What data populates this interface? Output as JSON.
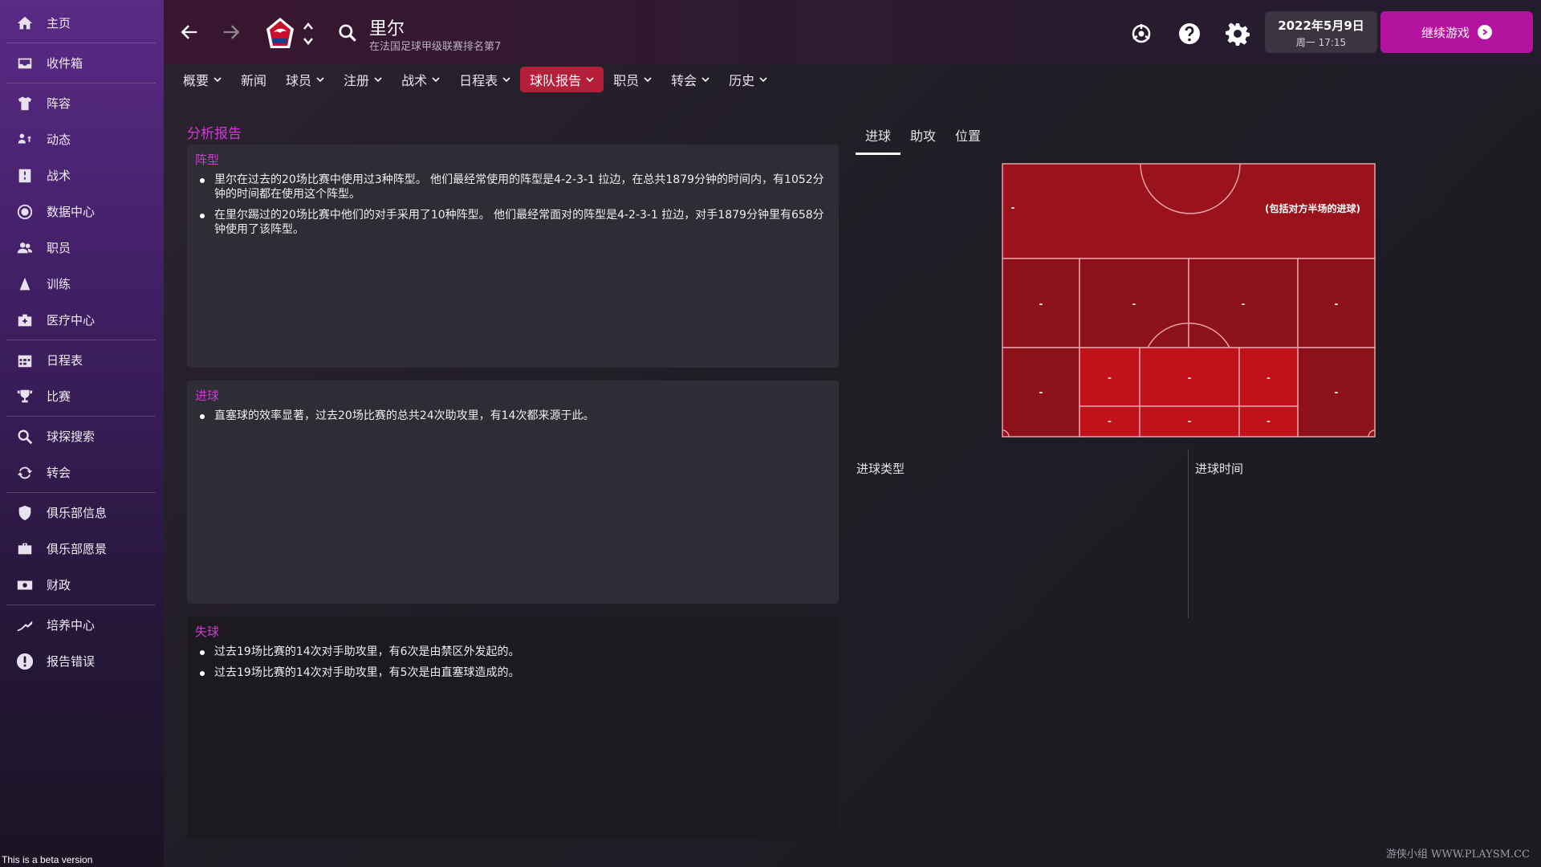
{
  "sidebar": {
    "items": [
      {
        "label": "主页",
        "icon": "home-icon"
      },
      {
        "label": "收件箱",
        "icon": "inbox-icon"
      },
      {
        "label": "阵容",
        "icon": "shirt-icon"
      },
      {
        "label": "动态",
        "icon": "dynamics-icon"
      },
      {
        "label": "战术",
        "icon": "tactics-icon"
      },
      {
        "label": "数据中心",
        "icon": "data-hub-icon"
      },
      {
        "label": "职员",
        "icon": "staff-icon"
      },
      {
        "label": "训练",
        "icon": "training-icon"
      },
      {
        "label": "医疗中心",
        "icon": "medical-icon"
      },
      {
        "label": "日程表",
        "icon": "calendar-icon"
      },
      {
        "label": "比赛",
        "icon": "trophy-icon"
      },
      {
        "label": "球探搜索",
        "icon": "search-icon"
      },
      {
        "label": "转会",
        "icon": "transfer-icon"
      },
      {
        "label": "俱乐部信息",
        "icon": "shield-icon"
      },
      {
        "label": "俱乐部愿景",
        "icon": "briefcase-icon"
      },
      {
        "label": "财政",
        "icon": "money-icon"
      },
      {
        "label": "培养中心",
        "icon": "development-icon"
      },
      {
        "label": "报告错误",
        "icon": "alert-icon"
      }
    ],
    "beta_text": "This is a beta version"
  },
  "header": {
    "club_name": "里尔",
    "club_subtitle": "在法国足球甲级联赛排名第7",
    "date": "2022年5月9日",
    "day_time": "周一 17:15",
    "continue_label": "继续游戏"
  },
  "menu": [
    {
      "label": "概要",
      "dropdown": true,
      "active": false
    },
    {
      "label": "新闻",
      "dropdown": false,
      "active": false
    },
    {
      "label": "球员",
      "dropdown": true,
      "active": false
    },
    {
      "label": "注册",
      "dropdown": true,
      "active": false
    },
    {
      "label": "战术",
      "dropdown": true,
      "active": false
    },
    {
      "label": "日程表",
      "dropdown": true,
      "active": false
    },
    {
      "label": "球队报告",
      "dropdown": true,
      "active": true
    },
    {
      "label": "职员",
      "dropdown": true,
      "active": false
    },
    {
      "label": "转会",
      "dropdown": true,
      "active": false
    },
    {
      "label": "历史",
      "dropdown": true,
      "active": false
    }
  ],
  "report": {
    "title": "分析报告",
    "formation": {
      "heading": "阵型",
      "bullets": [
        "里尔在过去的20场比赛中使用过3种阵型。 他们最经常使用的阵型是4-2-3-1 拉边，在总共1879分钟的时间内，有1052分钟的时间都在使用这个阵型。",
        "在里尔踢过的20场比赛中他们的对手采用了10种阵型。 他们最经常面对的阵型是4-2-3-1 拉边，对手1879分钟里有658分钟使用了该阵型。"
      ]
    },
    "goals_for": {
      "heading": "进球",
      "bullets": [
        "直塞球的效率显著，过去20场比赛的总共24次助攻里，有14次都来源于此。"
      ]
    },
    "goals_against": {
      "heading": "失球",
      "bullets": [
        "过去19场比赛的14次对手助攻里，有6次是由禁区外发起的。",
        "过去19场比赛的14次对手助攻里，有5次是由直塞球造成的。"
      ]
    }
  },
  "right_tabs": [
    {
      "label": "进球",
      "active": true
    },
    {
      "label": "助攻",
      "active": false
    },
    {
      "label": "位置",
      "active": false
    }
  ],
  "pitch": {
    "note": "(包括对方半场的进球)",
    "zone_value": "-",
    "colors": {
      "dark": "#8c111a",
      "mid": "#9a121c",
      "bright": "#c1121c",
      "line": "#e8a0a6"
    }
  },
  "goal_type_label": "进球类型",
  "goal_time_label": "进球时间",
  "watermark": "游侠小组 WWW.PLAYSM.CC",
  "colors": {
    "accent": "#b3139f",
    "menu_active": "#b51f3a",
    "heading": "#d03ad0"
  }
}
